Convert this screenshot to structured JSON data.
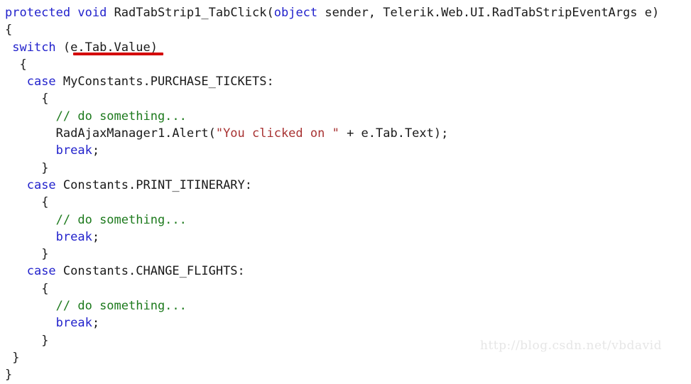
{
  "document": {
    "type": "source-code-screenshot",
    "language": "C#",
    "background_color": "#ffffff"
  },
  "syntax_colors": {
    "keyword": "#2222cc",
    "string": "#a83232",
    "comment": "#1d7a1d",
    "plain": "#1a1a1a",
    "annotation": "#d40000",
    "watermark": "#e6e6e6"
  },
  "code": {
    "lines": [
      {
        "indent": 0,
        "tokens": [
          {
            "kind": "keyword",
            "text": "protected"
          },
          {
            "kind": "plain",
            "text": " "
          },
          {
            "kind": "keyword",
            "text": "void"
          },
          {
            "kind": "plain",
            "text": " RadTabStrip1_TabClick("
          },
          {
            "kind": "keyword",
            "text": "object"
          },
          {
            "kind": "plain",
            "text": " sender, Telerik.Web.UI.RadTabStripEventArgs e)"
          }
        ]
      },
      {
        "indent": 0,
        "tokens": [
          {
            "kind": "plain",
            "text": "{"
          }
        ]
      },
      {
        "indent": 1,
        "tokens": [
          {
            "kind": "keyword",
            "text": "switch"
          },
          {
            "kind": "plain",
            "text": " (e.Tab.Value)"
          }
        ]
      },
      {
        "indent": 2,
        "tokens": [
          {
            "kind": "plain",
            "text": "{"
          }
        ]
      },
      {
        "indent": 3,
        "tokens": [
          {
            "kind": "keyword",
            "text": "case"
          },
          {
            "kind": "plain",
            "text": " MyConstants.PURCHASE_TICKETS:"
          }
        ]
      },
      {
        "indent": 5,
        "tokens": [
          {
            "kind": "plain",
            "text": "{"
          }
        ]
      },
      {
        "indent": 7,
        "tokens": [
          {
            "kind": "comment",
            "text": "// do something..."
          }
        ]
      },
      {
        "indent": 7,
        "tokens": [
          {
            "kind": "plain",
            "text": "RadAjaxManager1.Alert("
          },
          {
            "kind": "string",
            "text": "\"You clicked on \""
          },
          {
            "kind": "plain",
            "text": " + e.Tab.Text);"
          }
        ]
      },
      {
        "indent": 7,
        "tokens": [
          {
            "kind": "keyword",
            "text": "break"
          },
          {
            "kind": "plain",
            "text": ";"
          }
        ]
      },
      {
        "indent": 5,
        "tokens": [
          {
            "kind": "plain",
            "text": "}"
          }
        ]
      },
      {
        "indent": 3,
        "tokens": [
          {
            "kind": "keyword",
            "text": "case"
          },
          {
            "kind": "plain",
            "text": " Constants.PRINT_ITINERARY:"
          }
        ]
      },
      {
        "indent": 5,
        "tokens": [
          {
            "kind": "plain",
            "text": "{"
          }
        ]
      },
      {
        "indent": 7,
        "tokens": [
          {
            "kind": "comment",
            "text": "// do something..."
          }
        ]
      },
      {
        "indent": 7,
        "tokens": [
          {
            "kind": "keyword",
            "text": "break"
          },
          {
            "kind": "plain",
            "text": ";"
          }
        ]
      },
      {
        "indent": 5,
        "tokens": [
          {
            "kind": "plain",
            "text": "}"
          }
        ]
      },
      {
        "indent": 3,
        "tokens": [
          {
            "kind": "keyword",
            "text": "case"
          },
          {
            "kind": "plain",
            "text": " Constants.CHANGE_FLIGHTS:"
          }
        ]
      },
      {
        "indent": 5,
        "tokens": [
          {
            "kind": "plain",
            "text": "{"
          }
        ]
      },
      {
        "indent": 7,
        "tokens": [
          {
            "kind": "comment",
            "text": "// do something..."
          }
        ]
      },
      {
        "indent": 7,
        "tokens": [
          {
            "kind": "keyword",
            "text": "break"
          },
          {
            "kind": "plain",
            "text": ";"
          }
        ]
      },
      {
        "indent": 5,
        "tokens": [
          {
            "kind": "plain",
            "text": "}"
          }
        ]
      },
      {
        "indent": 1,
        "tokens": [
          {
            "kind": "plain",
            "text": "}"
          }
        ]
      },
      {
        "indent": 0,
        "tokens": [
          {
            "kind": "plain",
            "text": "}"
          }
        ]
      }
    ]
  },
  "annotation": {
    "kind": "red-underline",
    "target_text": "(e.Tab.Value)",
    "color": "#d40000"
  },
  "watermark": {
    "text": "http://blog.csdn.net/vbdavid"
  }
}
